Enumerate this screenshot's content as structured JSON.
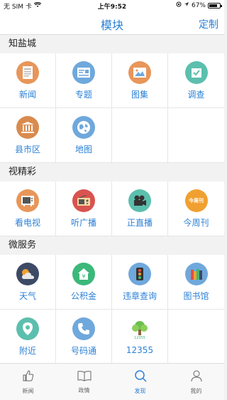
{
  "status": {
    "carrier": "无 SIM 卡",
    "time": "上午9:52",
    "battery": "67%",
    "battery_level": 0.67
  },
  "nav": {
    "title": "模块",
    "action": "定制"
  },
  "sections": [
    {
      "title": "知盐城",
      "items": [
        {
          "label": "新闻",
          "icon": "news-icon",
          "color": "#e8965a"
        },
        {
          "label": "专题",
          "icon": "topic-icon",
          "color": "#6fa8dc"
        },
        {
          "label": "图集",
          "icon": "gallery-icon",
          "color": "#e8965a"
        },
        {
          "label": "调查",
          "icon": "survey-icon",
          "color": "#5cbfae"
        },
        {
          "label": "县市区",
          "icon": "building-icon",
          "color": "#d98b4e"
        },
        {
          "label": "地图",
          "icon": "globe-icon",
          "color": "#6fa8dc"
        }
      ]
    },
    {
      "title": "视精彩",
      "items": [
        {
          "label": "看电视",
          "icon": "tv-icon",
          "color": "#e8965a"
        },
        {
          "label": "听广播",
          "icon": "radio-icon",
          "color": "#d9534f"
        },
        {
          "label": "正直播",
          "icon": "camera-icon",
          "color": "#5cbfae"
        },
        {
          "label": "今周刊",
          "icon": "weekly-icon",
          "color": "#f0a030",
          "badge": "今周刊"
        }
      ]
    },
    {
      "title": "微服务",
      "items": [
        {
          "label": "天气",
          "icon": "weather-icon",
          "color": "#3d4a66"
        },
        {
          "label": "公积金",
          "icon": "fund-icon",
          "color": "#3cb87a"
        },
        {
          "label": "违章查询",
          "icon": "traffic-light-icon",
          "color": "#6fa8dc"
        },
        {
          "label": "图书馆",
          "icon": "library-icon",
          "color": "#6fa8dc"
        },
        {
          "label": "附近",
          "icon": "location-icon",
          "color": "#5cbfae"
        },
        {
          "label": "号码通",
          "icon": "phone-icon",
          "color": "#6fa8dc"
        },
        {
          "label": "12355",
          "icon": "tree-logo-icon",
          "color": "#ffffff"
        }
      ]
    }
  ],
  "tabs": [
    {
      "label": "新闻",
      "icon": "thumbs-up-icon",
      "active": false
    },
    {
      "label": "政情",
      "icon": "book-icon",
      "active": false
    },
    {
      "label": "发现",
      "icon": "search-icon",
      "active": true
    },
    {
      "label": "我的",
      "icon": "person-icon",
      "active": false
    }
  ]
}
